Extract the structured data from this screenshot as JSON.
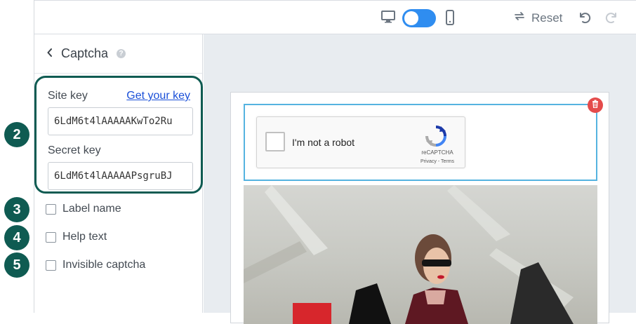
{
  "callouts": [
    "2",
    "3",
    "4",
    "5"
  ],
  "topbar": {
    "reset_label": "Reset",
    "icons": [
      "desktop-icon",
      "view-toggle",
      "mobile-icon",
      "reset-icon",
      "undo-icon",
      "redo-icon"
    ],
    "toggle_color": "#2f8df0"
  },
  "sidebar": {
    "title": "Captcha",
    "site_key": {
      "label": "Site key",
      "link": "Get your key",
      "value": "6LdM6t4lAAAAAKwTo2Ru"
    },
    "secret_key": {
      "label": "Secret key",
      "value": "6LdM6t4lAAAAAPsgruBJ"
    },
    "options": [
      {
        "label": "Label name",
        "checked": false
      },
      {
        "label": "Help text",
        "checked": false
      },
      {
        "label": "Invisible captcha",
        "checked": false
      }
    ],
    "highlight_color": "#0f5b52"
  },
  "canvas": {
    "recaptcha": {
      "label": "I'm not a robot",
      "brand": "reCAPTCHA",
      "terms": "Privacy - Terms"
    },
    "selection_color": "#55b3e0",
    "delete_color": "#e44b4b"
  }
}
